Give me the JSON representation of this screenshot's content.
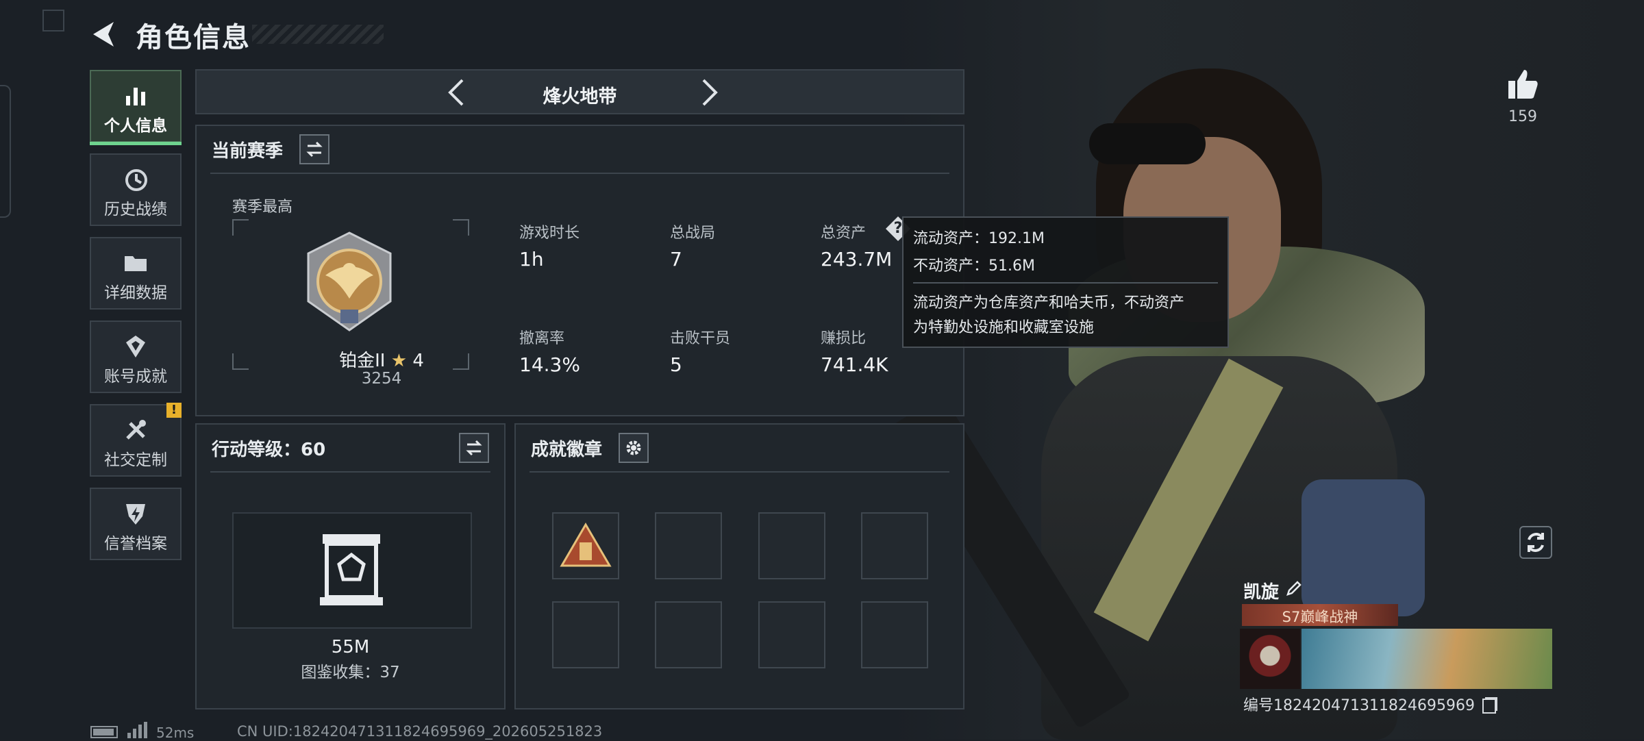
{
  "header": {
    "title": "角色信息"
  },
  "sidebar": {
    "items": [
      {
        "label": "个人信息",
        "icon": "bar-chart-icon"
      },
      {
        "label": "历史战绩",
        "icon": "history-clock-icon"
      },
      {
        "label": "详细数据",
        "icon": "folder-icon"
      },
      {
        "label": "账号成就",
        "icon": "achievement-icon"
      },
      {
        "label": "社交定制",
        "icon": "tools-icon",
        "badge": "!"
      },
      {
        "label": "信誉档案",
        "icon": "credit-shield-icon"
      }
    ]
  },
  "mode": {
    "title": "烽火地带"
  },
  "season": {
    "title": "当前赛季",
    "best_label": "赛季最高",
    "rank_name": "铂金II",
    "rank_stars": "4",
    "rank_score": "3254",
    "stats": [
      {
        "label": "游戏时长",
        "value": "1h"
      },
      {
        "label": "总战局",
        "value": "7"
      },
      {
        "label": "总资产",
        "value": "243.7M"
      },
      {
        "label": "撤离率",
        "value": "14.3%"
      },
      {
        "label": "击败干员",
        "value": "5"
      },
      {
        "label": "赚损比",
        "value": "741.4K"
      }
    ]
  },
  "tooltip": {
    "liquid": "流动资产：192.1M",
    "fixed": "不动资产：51.6M",
    "desc1": "流动资产为仓库资产和哈夫币，不动资产",
    "desc2": "为特勤处设施和收藏室设施"
  },
  "action_level": {
    "title": "行动等级：60",
    "value": "55M",
    "collection": "图鉴收集：37"
  },
  "badges": {
    "title": "成就徽章"
  },
  "player": {
    "likes": "159",
    "name": "凯旋",
    "honor_title": "S7巅峰战神",
    "id_line": "编号1824204713118246959​69"
  },
  "footer": {
    "ping": "52ms",
    "uid": "CN UID:18242047131182469596​9_202605251823"
  },
  "colors": {
    "accent_green": "#6fd48f",
    "warning": "#e8b12b",
    "panel_bg": "#20262c"
  }
}
